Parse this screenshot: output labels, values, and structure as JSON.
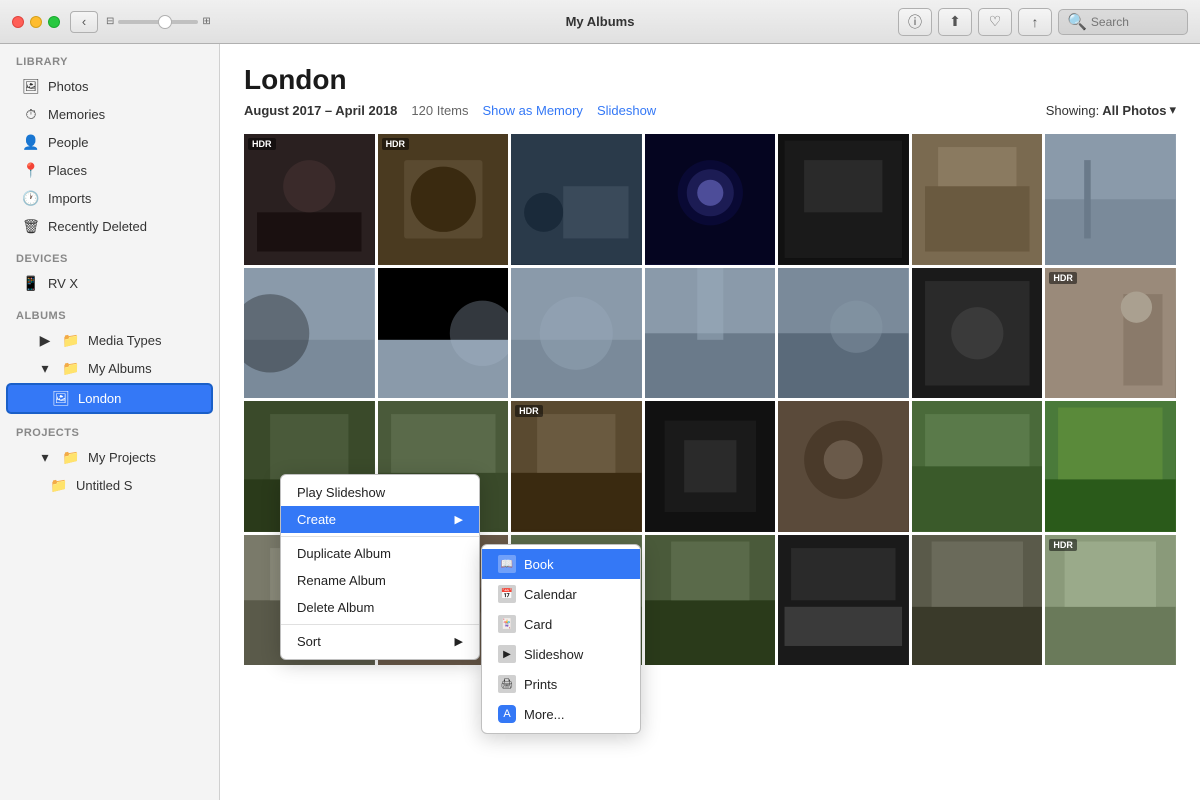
{
  "titleBar": {
    "title": "My Albums",
    "searchPlaceholder": "Search"
  },
  "sidebar": {
    "library_label": "Library",
    "items_library": [
      {
        "id": "photos",
        "label": "Photos",
        "icon": "🖼"
      },
      {
        "id": "memories",
        "label": "Memories",
        "icon": "⏱"
      },
      {
        "id": "people",
        "label": "People",
        "icon": "👤"
      },
      {
        "id": "places",
        "label": "Places",
        "icon": "📍"
      },
      {
        "id": "imports",
        "label": "Imports",
        "icon": "🕐"
      },
      {
        "id": "recently-deleted",
        "label": "Recently Deleted",
        "icon": "🗑"
      }
    ],
    "devices_label": "Devices",
    "items_devices": [
      {
        "id": "rv-x",
        "label": "RV X",
        "icon": "📱"
      }
    ],
    "albums_label": "Albums",
    "items_albums": [
      {
        "id": "media-types",
        "label": "Media Types",
        "icon": "📁",
        "indent": 1,
        "collapsed": true
      },
      {
        "id": "my-albums",
        "label": "My Albums",
        "icon": "📁",
        "indent": 1,
        "expanded": true
      },
      {
        "id": "london",
        "label": "London",
        "icon": "🖼",
        "indent": 2,
        "active": true
      }
    ],
    "projects_label": "Projects",
    "items_projects": [
      {
        "id": "my-projects",
        "label": "My Projects",
        "icon": "📁",
        "indent": 1,
        "expanded": true
      },
      {
        "id": "untitled",
        "label": "Untitled S",
        "icon": "📁",
        "indent": 2
      }
    ]
  },
  "content": {
    "album_title": "London",
    "date_range": "August 2017 – April 2018",
    "item_count": "120 Items",
    "show_as_memory": "Show as Memory",
    "slideshow": "Slideshow",
    "showing_label": "Showing:",
    "showing_value": "All Photos",
    "showing_chevron": "▾"
  },
  "contextMenu": {
    "play_slideshow": "Play Slideshow",
    "create": "Create",
    "duplicate_album": "Duplicate Album",
    "rename_album": "Rename Album",
    "delete_album": "Delete Album",
    "sort": "Sort"
  },
  "submenu": {
    "book": "Book",
    "calendar": "Calendar",
    "card": "Card",
    "slideshow": "Slideshow",
    "prints": "Prints",
    "more": "More..."
  },
  "photos": {
    "rows": [
      [
        {
          "hdr": true,
          "color": "#3a3535"
        },
        {
          "hdr": true,
          "color": "#5a4a30"
        },
        {
          "hdr": false,
          "color": "#2a3a4a"
        },
        {
          "hdr": false,
          "color": "#1a1a3a"
        },
        {
          "hdr": false,
          "color": "#1a1a1a"
        },
        {
          "hdr": false,
          "color": "#7a6a55"
        },
        {
          "hdr": false,
          "color": "#8a9aaa"
        }
      ],
      [
        {
          "hdr": false,
          "color": "#8a9aaa"
        },
        {
          "hdr": false,
          "color": "#7a8a9a"
        },
        {
          "hdr": false,
          "color": "#6a7a8a"
        },
        {
          "hdr": false,
          "color": "#5a6a7a"
        },
        {
          "hdr": false,
          "color": "#7a8a9a"
        },
        {
          "hdr": false,
          "color": "#3a3a3a"
        },
        {
          "hdr": true,
          "color": "#9a8a7a"
        }
      ],
      [
        {
          "hdr": false,
          "color": "#3a4a2a"
        },
        {
          "hdr": false,
          "color": "#4a5a3a"
        },
        {
          "hdr": true,
          "color": "#5a4a30"
        },
        {
          "hdr": false,
          "color": "#1a1a1a"
        },
        {
          "hdr": false,
          "color": "#5a4a3a"
        },
        {
          "hdr": false,
          "color": "#6a7a4a"
        },
        {
          "hdr": false,
          "color": "#3a6a2a"
        }
      ],
      [
        {
          "hdr": false,
          "color": "#7a7a6a"
        },
        {
          "hdr": false,
          "color": "#6a5a4a"
        },
        {
          "hdr": false,
          "color": "#5a6a4a"
        },
        {
          "hdr": false,
          "color": "#4a5a3a"
        },
        {
          "hdr": false,
          "color": "#2a2a2a"
        },
        {
          "hdr": false,
          "color": "#5a5a4a"
        },
        {
          "hdr": true,
          "color": "#8a9a8a"
        }
      ]
    ]
  }
}
